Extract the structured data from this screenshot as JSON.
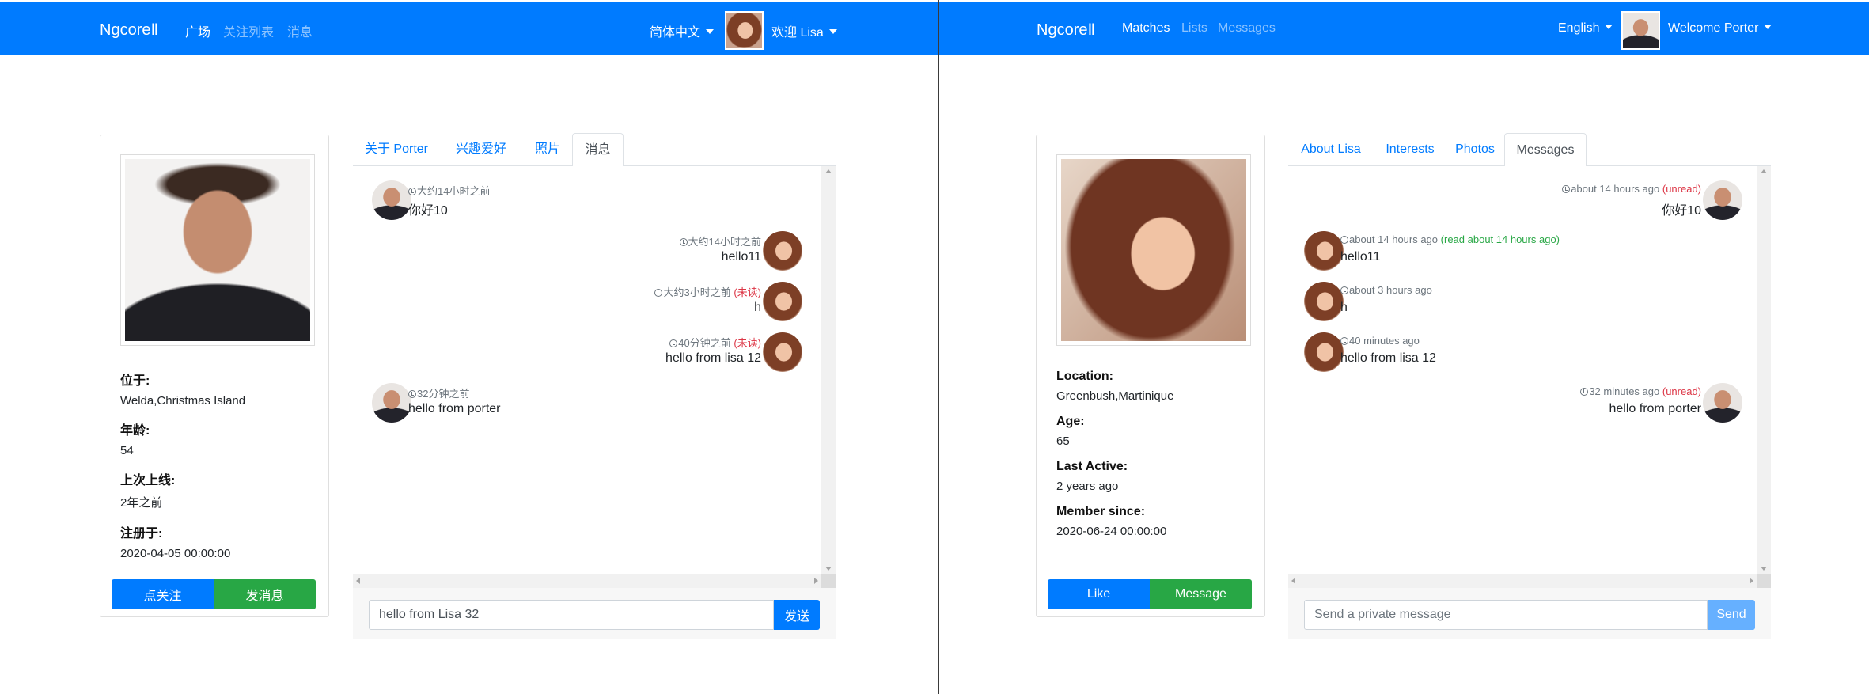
{
  "left": {
    "nav": {
      "brand": "NgcoreⅡ",
      "links": [
        "广场",
        "关注列表",
        "消息"
      ],
      "language": "简体中文",
      "welcome": "欢迎 Lisa"
    },
    "profile": {
      "location_label": "位于:",
      "location": "Welda,Christmas Island",
      "age_label": "年龄:",
      "age": "54",
      "last_active_label": "上次上线:",
      "last_active": "2年之前",
      "member_since_label": "注册于:",
      "member_since": "2020-04-05 00:00:00",
      "like_button": "点关注",
      "message_button": "发消息"
    },
    "tabs": [
      "关于 Porter",
      "兴趣爱好",
      "照片",
      "消息"
    ],
    "messages": [
      {
        "side": "left",
        "time": "大约14小时之前",
        "status": "",
        "text": "你好10"
      },
      {
        "side": "right",
        "time": "大约14小时之前",
        "status": "",
        "text": "hello11"
      },
      {
        "side": "right",
        "time": "大约3小时之前",
        "status": "(未读)",
        "text": "h"
      },
      {
        "side": "right",
        "time": "40分钟之前",
        "status": "(未读)",
        "text": "hello from lisa 12"
      },
      {
        "side": "left",
        "time": "32分钟之前",
        "status": "",
        "text": "hello from porter"
      }
    ],
    "input": {
      "value": "hello from Lisa 32",
      "placeholder": ""
    },
    "send_label": "发送"
  },
  "right": {
    "nav": {
      "brand": "NgcoreⅡ",
      "links": [
        "Matches",
        "Lists",
        "Messages"
      ],
      "language": "English",
      "welcome": "Welcome Porter"
    },
    "profile": {
      "location_label": "Location:",
      "location": "Greenbush,Martinique",
      "age_label": "Age:",
      "age": "65",
      "last_active_label": "Last Active:",
      "last_active": "2 years ago",
      "member_since_label": "Member since:",
      "member_since": "2020-06-24 00:00:00",
      "like_button": "Like",
      "message_button": "Message"
    },
    "tabs": [
      "About Lisa",
      "Interests",
      "Photos",
      "Messages"
    ],
    "messages": [
      {
        "side": "right",
        "time": "about 14 hours ago",
        "status": "(unread)",
        "text": "你好10"
      },
      {
        "side": "left",
        "time": "about 14 hours ago",
        "status": "(read about 14 hours ago)",
        "text": "hello11"
      },
      {
        "side": "left",
        "time": "about 3 hours ago",
        "status": "",
        "text": "h"
      },
      {
        "side": "left",
        "time": "40 minutes ago",
        "status": "",
        "text": "hello from lisa 12"
      },
      {
        "side": "right",
        "time": "32 minutes ago",
        "status": "(unread)",
        "text": "hello from porter"
      }
    ],
    "input": {
      "value": "",
      "placeholder": "Send a private message"
    },
    "send_label": "Send"
  },
  "colors": {
    "primary": "#007bff",
    "success": "#28a745",
    "danger": "#dc3545",
    "muted": "#6c757d"
  },
  "icons": {
    "timestamp": "clock-icon",
    "avatar": "user-avatar"
  }
}
